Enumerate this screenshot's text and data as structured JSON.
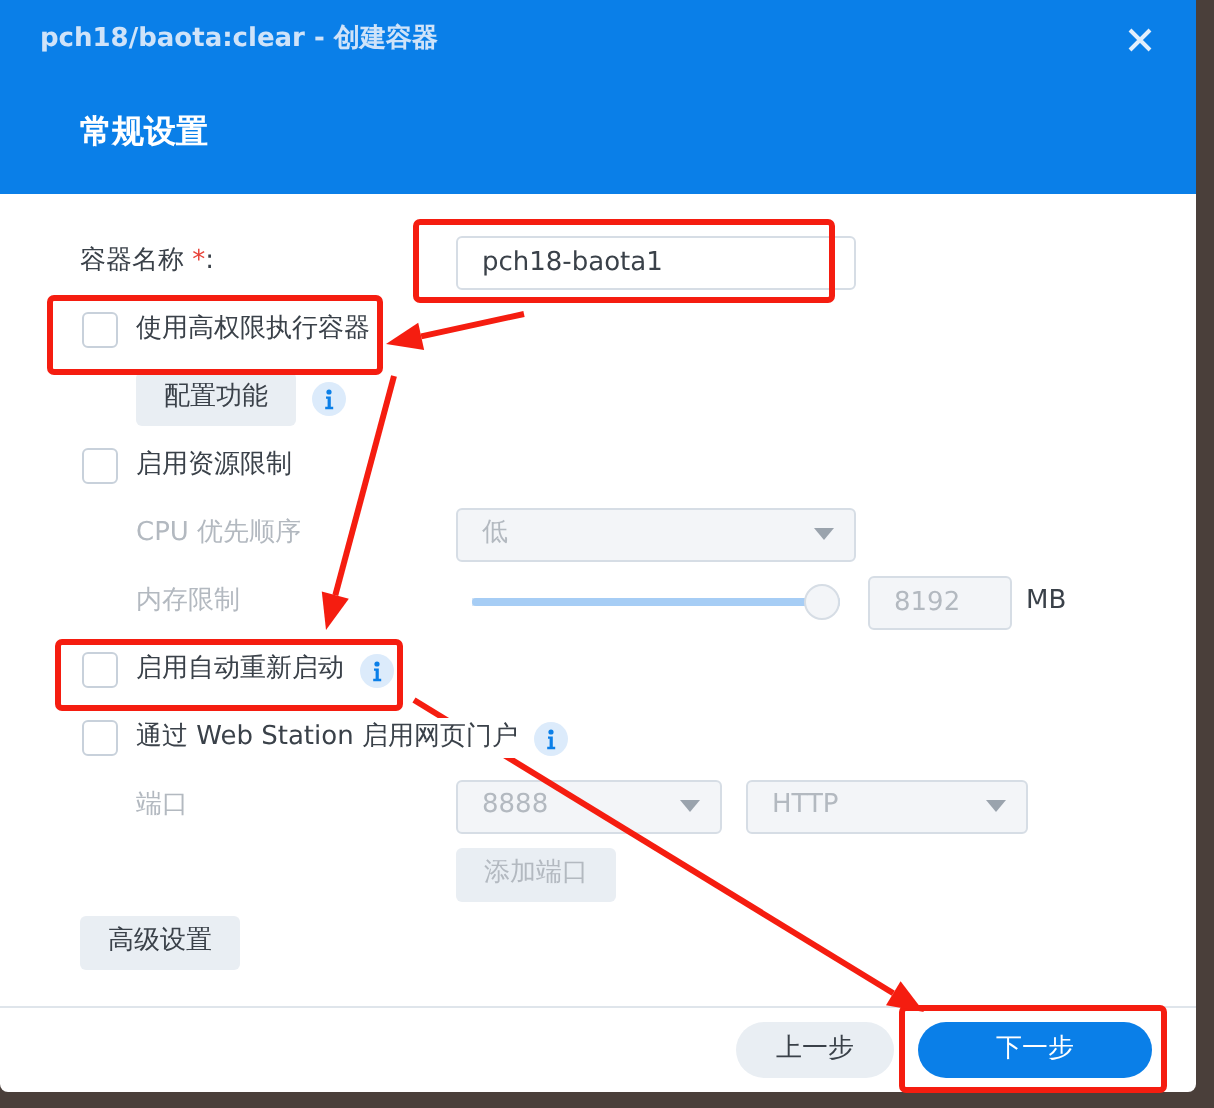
{
  "window": {
    "title": "pch18/baota:clear - 创建容器"
  },
  "header": {
    "title": "常规设置"
  },
  "form": [
    {
      "kind": "text-field",
      "label": "容器名称",
      "required_mark": "*",
      "label_end": ":",
      "value": "pch18-baota1"
    },
    {
      "kind": "checkbox",
      "label": "使用高权限执行容器",
      "checked": false,
      "info": false
    },
    {
      "kind": "sub-button",
      "label": "配置功能",
      "info": true
    },
    {
      "kind": "checkbox",
      "label": "启用资源限制",
      "checked": false,
      "info": false
    },
    {
      "kind": "select",
      "label": "CPU 优先顺序",
      "value": "低",
      "disabled": true
    },
    {
      "kind": "slider",
      "label": "内存限制",
      "level": 1.0,
      "value": "8192",
      "unit": "MB",
      "disabled": true
    },
    {
      "kind": "checkbox",
      "label": "启用自动重新启动",
      "checked": false,
      "info": true
    },
    {
      "kind": "checkbox",
      "label": "通过 Web Station 启用网页门户",
      "checked": false,
      "info": true
    },
    {
      "kind": "ports",
      "label": "端口",
      "port": "8888",
      "protocol": "HTTP",
      "disabled": true
    },
    {
      "kind": "control-button",
      "label": "添加端口",
      "disabled": true
    },
    {
      "kind": "button",
      "label": "高级设置",
      "disabled": false
    }
  ],
  "footer": {
    "buttons": [
      {
        "label": "上一步",
        "primary": false
      },
      {
        "label": "下一步",
        "primary": true
      }
    ]
  }
}
